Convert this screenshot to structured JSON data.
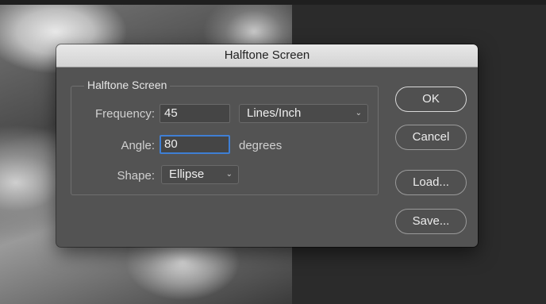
{
  "dialog": {
    "title": "Halftone Screen",
    "group_title": "Halftone Screen",
    "frequency": {
      "label": "Frequency:",
      "value": "45",
      "unit_selected": "Lines/Inch"
    },
    "angle": {
      "label": "Angle:",
      "value": "80",
      "unit": "degrees"
    },
    "shape": {
      "label": "Shape:",
      "selected": "Ellipse"
    },
    "buttons": {
      "ok": "OK",
      "cancel": "Cancel",
      "load": "Load...",
      "save": "Save..."
    }
  },
  "colors": {
    "dialog_bg": "#535353",
    "focus_ring": "#3f7fd4"
  },
  "icons": {
    "select_chevron": "chevron-down-icon"
  }
}
